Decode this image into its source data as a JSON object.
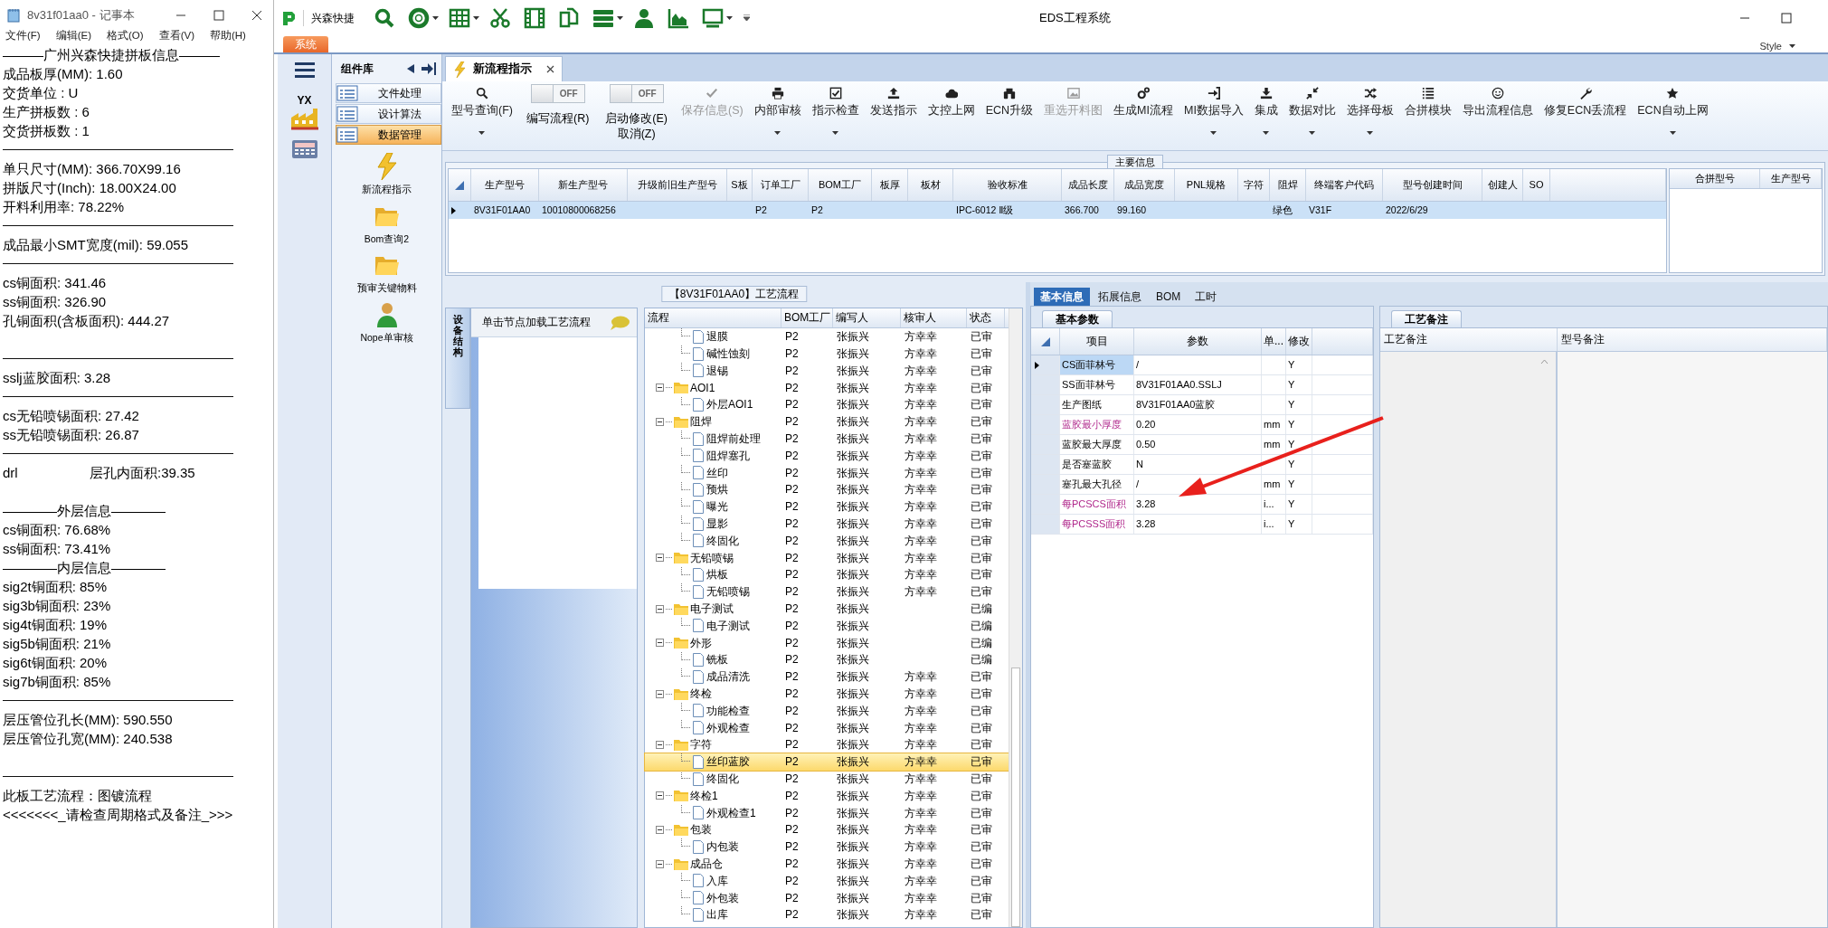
{
  "notepad": {
    "title": "8v31f01aa0 - 记事本",
    "menu": [
      "文件(F)",
      "编辑(E)",
      "格式(O)",
      "查看(V)",
      "帮助(H)"
    ],
    "lines": [
      {
        "kind": "text",
        "text": "———广州兴森快捷拼板信息———"
      },
      {
        "kind": "text",
        "text": "成品板厚(MM): 1.60"
      },
      {
        "kind": "text",
        "text": "交货单位 : U"
      },
      {
        "kind": "text",
        "text": "生产拼板数 : 6"
      },
      {
        "kind": "text",
        "text": "交货拼板数 : 1"
      },
      {
        "kind": "rule"
      },
      {
        "kind": "text",
        "text": "单只尺寸(MM): 366.70X99.16"
      },
      {
        "kind": "text",
        "text": "拼版尺寸(Inch): 18.00X24.00"
      },
      {
        "kind": "text",
        "text": "开料利用率: 78.22%"
      },
      {
        "kind": "rule"
      },
      {
        "kind": "text",
        "text": "成品最小SMT宽度(mil): 59.055"
      },
      {
        "kind": "rule"
      },
      {
        "kind": "text",
        "text": "cs铜面积: 341.46"
      },
      {
        "kind": "text",
        "text": "ss铜面积: 326.90"
      },
      {
        "kind": "text",
        "text": "孔铜面积(含板面积): 444.27"
      },
      {
        "kind": "blank"
      },
      {
        "kind": "rule"
      },
      {
        "kind": "text",
        "text": "sslj蓝胶面积: 3.28"
      },
      {
        "kind": "rule"
      },
      {
        "kind": "text",
        "text": "cs无铅喷锡面积: 27.42"
      },
      {
        "kind": "text",
        "text": "ss无铅喷锡面积: 26.87"
      },
      {
        "kind": "rule"
      },
      {
        "kind": "columns",
        "parts": [
          "drl",
          "层孔内面积:39.35"
        ]
      },
      {
        "kind": "blank"
      },
      {
        "kind": "text",
        "text": "————外层信息————"
      },
      {
        "kind": "text",
        "text": "cs铜面积: 76.68%"
      },
      {
        "kind": "text",
        "text": "ss铜面积: 73.41%"
      },
      {
        "kind": "text",
        "text": "————内层信息————"
      },
      {
        "kind": "text",
        "text": "sig2t铜面积: 85%"
      },
      {
        "kind": "text",
        "text": "sig3b铜面积: 23%"
      },
      {
        "kind": "text",
        "text": "sig4t铜面积: 19%"
      },
      {
        "kind": "text",
        "text": "sig5b铜面积: 21%"
      },
      {
        "kind": "text",
        "text": "sig6t铜面积: 20%"
      },
      {
        "kind": "text",
        "text": "sig7b铜面积: 85%"
      },
      {
        "kind": "rule"
      },
      {
        "kind": "text",
        "text": "层压管位孔长(MM): 590.550"
      },
      {
        "kind": "text",
        "text": "层压管位孔宽(MM): 240.538"
      },
      {
        "kind": "blank"
      },
      {
        "kind": "rule"
      },
      {
        "kind": "text",
        "text": "此板工艺流程：图镀流程"
      },
      {
        "kind": "text",
        "text": "<<<<<<<_请检查周期格式及备注_>>>"
      }
    ]
  },
  "app": {
    "brand": "兴森快捷",
    "title": "EDS工程系统",
    "system_tab": "系统",
    "style_menu": "Style",
    "logo_text": "YX"
  },
  "component_library": {
    "title": "组件库",
    "categories": [
      {
        "label": "文件处理",
        "selected": false
      },
      {
        "label": "设计算法",
        "selected": false
      },
      {
        "label": "数据管理",
        "selected": true
      }
    ],
    "tools": [
      {
        "label": "新流程指示"
      },
      {
        "label": "Bom查询2"
      },
      {
        "label": "预审关键物料"
      },
      {
        "label": "Nope单审核"
      }
    ]
  },
  "document_tab": {
    "label": "新流程指示"
  },
  "ribbon": [
    {
      "kind": "button",
      "label": "型号查询(F)",
      "dropdown": true,
      "disabled": false
    },
    {
      "kind": "toggle",
      "label": "编写流程(R)",
      "switch_text": "OFF",
      "on": false
    },
    {
      "kind": "toggle",
      "label": "启动修改(E)",
      "sublabel": "取消(Z)",
      "switch_text": "OFF",
      "on": false
    },
    {
      "kind": "button",
      "label": "保存信息(S)",
      "dropdown": false,
      "disabled": true
    },
    {
      "kind": "button",
      "label": "内部审核",
      "dropdown": true,
      "disabled": false
    },
    {
      "kind": "button",
      "label": "指示检查",
      "dropdown": true,
      "disabled": false
    },
    {
      "kind": "button",
      "label": "发送指示",
      "dropdown": false,
      "disabled": false
    },
    {
      "kind": "button",
      "label": "文控上网",
      "dropdown": false,
      "disabled": false
    },
    {
      "kind": "button",
      "label": "ECN升级",
      "dropdown": false,
      "disabled": false
    },
    {
      "kind": "button",
      "label": "重选开料图",
      "dropdown": false,
      "disabled": true
    },
    {
      "kind": "button",
      "label": "生成MI流程",
      "dropdown": false,
      "disabled": false
    },
    {
      "kind": "button",
      "label": "MI数据导入",
      "dropdown": true,
      "disabled": false
    },
    {
      "kind": "button",
      "label": "集成",
      "dropdown": true,
      "disabled": false
    },
    {
      "kind": "button",
      "label": "数据对比",
      "dropdown": true,
      "disabled": false
    },
    {
      "kind": "button",
      "label": "选择母板",
      "dropdown": true,
      "disabled": false
    },
    {
      "kind": "button",
      "label": "合拼模块",
      "dropdown": false,
      "disabled": false
    },
    {
      "kind": "button",
      "label": "导出流程信息",
      "dropdown": false,
      "disabled": false
    },
    {
      "kind": "button",
      "label": "修复ECN丢流程",
      "dropdown": false,
      "disabled": false
    },
    {
      "kind": "button",
      "label": "ECN自动上网",
      "dropdown": true,
      "disabled": false
    }
  ],
  "main_info": {
    "title": "主要信息",
    "row_selected": true,
    "columns": [
      {
        "label": "生产型号",
        "value": "8V31F01AA0"
      },
      {
        "label": "新生产型号",
        "value": "10010800068256"
      },
      {
        "label": "升级前旧生产型号"
      },
      {
        "label": "S板"
      },
      {
        "label": "订单工厂",
        "value": "P2"
      },
      {
        "label": "BOM工厂",
        "value": "P2"
      },
      {
        "label": "板厚"
      },
      {
        "label": "板材"
      },
      {
        "label": "验收标准",
        "value": "IPC-6012 Ⅱ级"
      },
      {
        "label": "成品长度",
        "value": "366.700"
      },
      {
        "label": "成品宽度",
        "value": "99.160"
      },
      {
        "label": "PNL规格"
      },
      {
        "label": "字符"
      },
      {
        "label": "阻焊",
        "value": "绿色"
      },
      {
        "label": "终端客户代码",
        "value": "V31F"
      },
      {
        "label": "型号创建时间",
        "value": "2022/6/29"
      },
      {
        "label": "创建人"
      },
      {
        "label": "SO"
      }
    ],
    "side_columns": [
      "合拼型号",
      "生产型号"
    ]
  },
  "process": {
    "title": "【8V31F01AA0】工艺流程",
    "side_tab": "设备结构",
    "hint": "单击节点加载工艺流程",
    "columns": [
      "流程",
      "BOM工厂",
      "编写人",
      "核审人",
      "状态"
    ],
    "continued": [
      {
        "label": "退膜",
        "bom": "P2",
        "writer": "张振兴",
        "reviewer": "方幸幸",
        "status": "已审",
        "selected": false
      },
      {
        "label": "碱性蚀刻",
        "bom": "P2",
        "writer": "张振兴",
        "reviewer": "方幸幸",
        "status": "已审",
        "selected": false
      },
      {
        "label": "退锡",
        "bom": "P2",
        "writer": "张振兴",
        "reviewer": "方幸幸",
        "status": "已审",
        "selected": false
      }
    ],
    "nodes": [
      {
        "label": "AOI1",
        "bom": "P2",
        "writer": "张振兴",
        "reviewer": "方幸幸",
        "status": "已审",
        "selected": false,
        "expanded": true,
        "children": [
          {
            "label": "外层AOI1",
            "bom": "P2",
            "writer": "张振兴",
            "reviewer": "方幸幸",
            "status": "已审",
            "selected": false
          }
        ]
      },
      {
        "label": "阻焊",
        "bom": "P2",
        "writer": "张振兴",
        "reviewer": "方幸幸",
        "status": "已审",
        "selected": false,
        "expanded": true,
        "children": [
          {
            "label": "阻焊前处理",
            "bom": "P2",
            "writer": "张振兴",
            "reviewer": "方幸幸",
            "status": "已审",
            "selected": false
          },
          {
            "label": "阻焊塞孔",
            "bom": "P2",
            "writer": "张振兴",
            "reviewer": "方幸幸",
            "status": "已审",
            "selected": false
          },
          {
            "label": "丝印",
            "bom": "P2",
            "writer": "张振兴",
            "reviewer": "方幸幸",
            "status": "已审",
            "selected": false
          },
          {
            "label": "预烘",
            "bom": "P2",
            "writer": "张振兴",
            "reviewer": "方幸幸",
            "status": "已审",
            "selected": false
          },
          {
            "label": "曝光",
            "bom": "P2",
            "writer": "张振兴",
            "reviewer": "方幸幸",
            "status": "已审",
            "selected": false
          },
          {
            "label": "显影",
            "bom": "P2",
            "writer": "张振兴",
            "reviewer": "方幸幸",
            "status": "已审",
            "selected": false
          },
          {
            "label": "终固化",
            "bom": "P2",
            "writer": "张振兴",
            "reviewer": "方幸幸",
            "status": "已审",
            "selected": false
          }
        ]
      },
      {
        "label": "无铅喷锡",
        "bom": "P2",
        "writer": "张振兴",
        "reviewer": "方幸幸",
        "status": "已审",
        "selected": false,
        "expanded": true,
        "children": [
          {
            "label": "烘板",
            "bom": "P2",
            "writer": "张振兴",
            "reviewer": "方幸幸",
            "status": "已审",
            "selected": false
          },
          {
            "label": "无铅喷锡",
            "bom": "P2",
            "writer": "张振兴",
            "reviewer": "方幸幸",
            "status": "已审",
            "selected": false
          }
        ]
      },
      {
        "label": "电子测试",
        "bom": "P2",
        "writer": "张振兴",
        "status": "已编",
        "selected": false,
        "expanded": true,
        "children": [
          {
            "label": "电子测试",
            "bom": "P2",
            "writer": "张振兴",
            "status": "已编",
            "selected": false
          }
        ]
      },
      {
        "label": "外形",
        "bom": "P2",
        "writer": "张振兴",
        "status": "已编",
        "selected": false,
        "expanded": true,
        "children": [
          {
            "label": "铣板",
            "bom": "P2",
            "writer": "张振兴",
            "status": "已编",
            "selected": false
          },
          {
            "label": "成品清洗",
            "bom": "P2",
            "writer": "张振兴",
            "reviewer": "方幸幸",
            "status": "已审",
            "selected": false
          }
        ]
      },
      {
        "label": "终检",
        "bom": "P2",
        "writer": "张振兴",
        "reviewer": "方幸幸",
        "status": "已审",
        "selected": false,
        "expanded": true,
        "children": [
          {
            "label": "功能检查",
            "bom": "P2",
            "writer": "张振兴",
            "reviewer": "方幸幸",
            "status": "已审",
            "selected": false
          },
          {
            "label": "外观检查",
            "bom": "P2",
            "writer": "张振兴",
            "reviewer": "方幸幸",
            "status": "已审",
            "selected": false
          }
        ]
      },
      {
        "label": "字符",
        "bom": "P2",
        "writer": "张振兴",
        "reviewer": "方幸幸",
        "status": "已审",
        "selected": false,
        "expanded": true,
        "children": [
          {
            "label": "丝印蓝胶",
            "bom": "P2",
            "writer": "张振兴",
            "reviewer": "方幸幸",
            "status": "已审",
            "selected": true
          },
          {
            "label": "终固化",
            "bom": "P2",
            "writer": "张振兴",
            "reviewer": "方幸幸",
            "status": "已审",
            "selected": false
          }
        ]
      },
      {
        "label": "终检1",
        "bom": "P2",
        "writer": "张振兴",
        "reviewer": "方幸幸",
        "status": "已审",
        "selected": false,
        "expanded": true,
        "children": [
          {
            "label": "外观检查1",
            "bom": "P2",
            "writer": "张振兴",
            "reviewer": "方幸幸",
            "status": "已审",
            "selected": false
          }
        ]
      },
      {
        "label": "包装",
        "bom": "P2",
        "writer": "张振兴",
        "reviewer": "方幸幸",
        "status": "已审",
        "selected": false,
        "expanded": true,
        "children": [
          {
            "label": "内包装",
            "bom": "P2",
            "writer": "张振兴",
            "reviewer": "方幸幸",
            "status": "已审",
            "selected": false
          }
        ]
      },
      {
        "label": "成品仓",
        "bom": "P2",
        "writer": "张振兴",
        "reviewer": "方幸幸",
        "status": "已审",
        "selected": false,
        "expanded": true,
        "children": [
          {
            "label": "入库",
            "bom": "P2",
            "writer": "张振兴",
            "reviewer": "方幸幸",
            "status": "已审",
            "selected": false
          },
          {
            "label": "外包装",
            "bom": "P2",
            "writer": "张振兴",
            "reviewer": "方幸幸",
            "status": "已审",
            "selected": false
          },
          {
            "label": "出库",
            "bom": "P2",
            "writer": "张振兴",
            "reviewer": "方幸幸",
            "status": "已审",
            "selected": false
          }
        ]
      }
    ]
  },
  "detail_tabs": [
    {
      "label": "基本信息",
      "selected": true
    },
    {
      "label": "拓展信息",
      "selected": false
    },
    {
      "label": "BOM",
      "selected": false
    },
    {
      "label": "工时",
      "selected": false
    }
  ],
  "basic_params": {
    "tab": "基本参数",
    "columns": [
      "项目",
      "参数",
      "单...",
      "修改"
    ],
    "rows": [
      {
        "item": "CS面菲林号",
        "value": "/",
        "modify": "Y",
        "emphasis": false,
        "selected": true
      },
      {
        "item": "SS面菲林号",
        "value": "8V31F01AA0.SSLJ",
        "modify": "Y",
        "emphasis": false,
        "selected": false
      },
      {
        "item": "生产图纸",
        "value": "8V31F01AA0蓝胶",
        "modify": "Y",
        "emphasis": false,
        "selected": false
      },
      {
        "item": "蓝胶最小厚度",
        "value": "0.20",
        "unit": "mm",
        "modify": "Y",
        "emphasis": true,
        "selected": false
      },
      {
        "item": "蓝胶最大厚度",
        "value": "0.50",
        "unit": "mm",
        "modify": "Y",
        "emphasis": false,
        "selected": false
      },
      {
        "item": "是否塞蓝胶",
        "value": "N",
        "modify": "Y",
        "emphasis": false,
        "selected": false
      },
      {
        "item": "塞孔最大孔径",
        "value": "/",
        "unit": "mm",
        "modify": "Y",
        "emphasis": false,
        "selected": false
      },
      {
        "item": "每PCSCS面积",
        "value": "3.28",
        "unit": "i...",
        "modify": "Y",
        "emphasis": true,
        "selected": false
      },
      {
        "item": "每PCSSS面积",
        "value": "3.28",
        "unit": "i...",
        "modify": "Y",
        "emphasis": true,
        "selected": false
      }
    ]
  },
  "remarks": {
    "tab": "工艺备注",
    "columns": [
      "工艺备注",
      "型号备注"
    ]
  }
}
